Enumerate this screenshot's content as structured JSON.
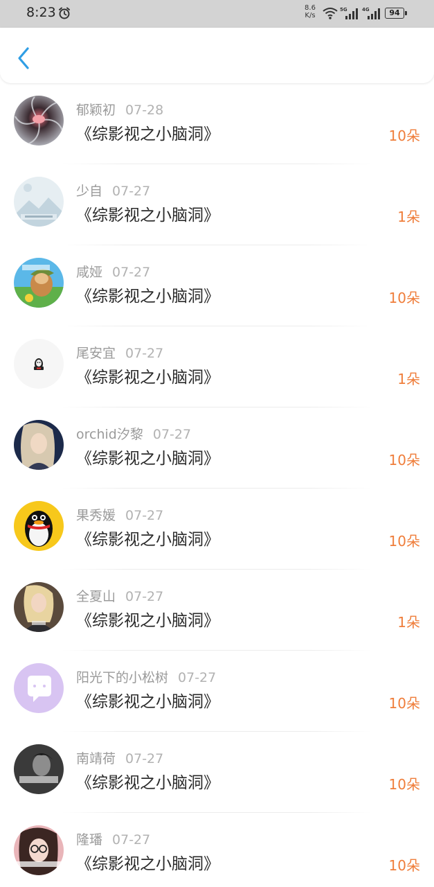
{
  "status_bar": {
    "time": "8:23",
    "net_speed_value": "8.6",
    "net_speed_unit": "K/s",
    "sim1": "5G",
    "sim2": "4G",
    "battery": "94"
  },
  "header": {
    "back_icon": "chevron-left-icon"
  },
  "colors": {
    "accent": "#2f9ee5",
    "amount": "#ef7d3a",
    "status_bar_bg": "#d3d3d3"
  },
  "items": [
    {
      "name": "郁颖初",
      "date": "07-28",
      "title": "《综影视之小脑洞》",
      "amount": "10朵"
    },
    {
      "name": "少自",
      "date": "07-27",
      "title": "《综影视之小脑洞》",
      "amount": "1朵"
    },
    {
      "name": "咸娅",
      "date": "07-27",
      "title": "《综影视之小脑洞》",
      "amount": "10朵"
    },
    {
      "name": "尾安宜",
      "date": "07-27",
      "title": "《综影视之小脑洞》",
      "amount": "1朵"
    },
    {
      "name": "orchid汐黎",
      "date": "07-27",
      "title": "《综影视之小脑洞》",
      "amount": "10朵"
    },
    {
      "name": "果秀媛",
      "date": "07-27",
      "title": "《综影视之小脑洞》",
      "amount": "10朵"
    },
    {
      "name": "全夏山",
      "date": "07-27",
      "title": "《综影视之小脑洞》",
      "amount": "1朵"
    },
    {
      "name": "阳光下的小松树",
      "date": "07-27",
      "title": "《综影视之小脑洞》",
      "amount": "10朵"
    },
    {
      "name": "南靖荷",
      "date": "07-27",
      "title": "《综影视之小脑洞》",
      "amount": "10朵"
    },
    {
      "name": "隆璠",
      "date": "07-27",
      "title": "《综影视之小脑洞》",
      "amount": "10朵"
    }
  ]
}
